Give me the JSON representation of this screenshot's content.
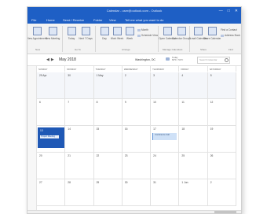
{
  "window": {
    "title": "Calendar - user@outlook.com - Outlook",
    "controls": [
      "—",
      "□",
      "✕"
    ]
  },
  "menu": [
    "File",
    "Home",
    "Send / Receive",
    "Folder",
    "View",
    "Tell me what you want to do"
  ],
  "ribbon": {
    "buttons": [
      {
        "label": "New Appointment",
        "icon": "calendar-new-icon"
      },
      {
        "label": "New Meeting",
        "icon": "meeting-icon"
      },
      {
        "label": "Today",
        "icon": "today-icon"
      },
      {
        "label": "Next 7 Days",
        "icon": "next7-icon"
      },
      {
        "label": "Day",
        "icon": "day-view-icon"
      },
      {
        "label": "Work Week",
        "icon": "work-week-icon"
      },
      {
        "label": "Week",
        "icon": "week-view-icon"
      },
      {
        "label": "Open Calendar",
        "icon": "open-calendar-icon"
      },
      {
        "label": "Calendar Groups",
        "icon": "calendar-groups-icon"
      },
      {
        "label": "E-mail Calendar",
        "icon": "email-calendar-icon"
      },
      {
        "label": "Share Calendar",
        "icon": "share-calendar-icon"
      },
      {
        "label": "Publish Online",
        "icon": "publish-icon"
      }
    ],
    "small_items": [
      "Month",
      "Schedule View",
      "Find a Contact",
      "Address Book"
    ],
    "groups": [
      "New",
      "Go To",
      "Arrange",
      "Manage Calendars",
      "Share",
      "Find"
    ]
  },
  "nav": {
    "prev": "◀",
    "next": "▶",
    "month_label": "May 2018",
    "location": "Washington, DC",
    "weather_line1": "Today",
    "weather_line2": "63°F / 51°F",
    "search_placeholder": "Search Calendar"
  },
  "calendar": {
    "weekdays": [
      "SUNDAY",
      "MONDAY",
      "TUESDAY",
      "WEDNESDAY",
      "THURSDAY",
      "FRIDAY",
      "SATURDAY"
    ],
    "weeks": [
      [
        "29 Apr",
        "30",
        "1 May",
        "2",
        "3",
        "4",
        "5"
      ],
      [
        "6",
        "7",
        "8",
        "9",
        "10",
        "11",
        "12"
      ],
      [
        "13",
        "14",
        "15",
        "16",
        "17",
        "18",
        "19"
      ],
      [
        "20",
        "21",
        "22",
        "23",
        "24",
        "25",
        "26"
      ],
      [
        "27",
        "28",
        "29",
        "30",
        "31",
        "1 Jun",
        "2"
      ]
    ],
    "selected_event": "Project Meeting",
    "event_thursday": "Conference Call"
  },
  "colors": {
    "titlebar": "#1e5fc5",
    "selected": "#1f58b5",
    "event": "#cfe1f7"
  }
}
